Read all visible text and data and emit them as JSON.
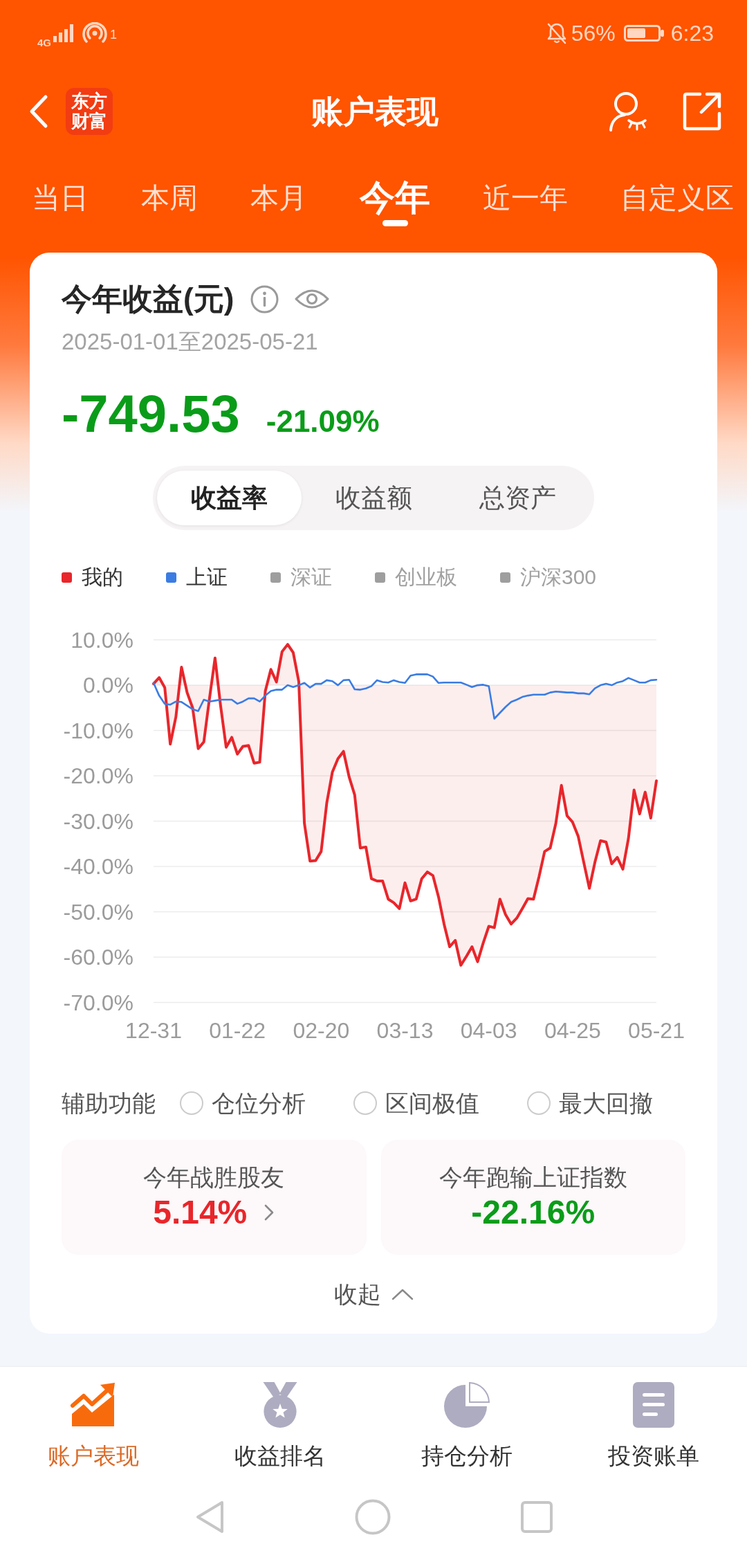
{
  "status_bar": {
    "network": "4G",
    "hotspot_count": "1",
    "battery": "56%",
    "time": "6:23"
  },
  "header": {
    "logo_text": "东方财富",
    "title": "账户表现"
  },
  "period_tabs": [
    {
      "label": "当日",
      "selected": false
    },
    {
      "label": "本周",
      "selected": false
    },
    {
      "label": "本月",
      "selected": false
    },
    {
      "label": "今年",
      "selected": true
    },
    {
      "label": "近一年",
      "selected": false
    },
    {
      "label": "自定义区",
      "selected": false
    }
  ],
  "summary": {
    "title": "今年收益(元)",
    "date_range": "2025-01-01至2025-05-21",
    "amount": "-749.53",
    "rate": "-21.09%",
    "positive": false
  },
  "metric_tabs": [
    {
      "label": "收益率",
      "selected": true
    },
    {
      "label": "收益额",
      "selected": false
    },
    {
      "label": "总资产",
      "selected": false
    }
  ],
  "chart": {
    "legend": [
      {
        "label": "我的",
        "selected": true,
        "color": "#e8262b"
      },
      {
        "label": "上证",
        "selected": true,
        "color": "#3b7ce2"
      },
      {
        "label": "深证",
        "selected": false,
        "color": "#9e9e9e"
      },
      {
        "label": "创业板",
        "selected": false,
        "color": "#9e9e9e"
      },
      {
        "label": "沪深300",
        "selected": false,
        "color": "#9e9e9e"
      }
    ],
    "chart_data": {
      "type": "area",
      "grid": true,
      "categories": [
        "12-31",
        null,
        null,
        null,
        null,
        null,
        null,
        null,
        null,
        null,
        null,
        null,
        null,
        null,
        null,
        "01-22",
        null,
        null,
        null,
        null,
        null,
        null,
        null,
        null,
        null,
        null,
        null,
        null,
        null,
        null,
        "02-20",
        null,
        null,
        null,
        null,
        null,
        null,
        null,
        null,
        null,
        null,
        null,
        null,
        null,
        null,
        "03-13",
        null,
        null,
        null,
        null,
        null,
        null,
        null,
        null,
        null,
        null,
        null,
        null,
        null,
        null,
        "04-03",
        null,
        null,
        null,
        null,
        null,
        null,
        null,
        null,
        null,
        null,
        null,
        null,
        null,
        null,
        "04-25",
        null,
        null,
        null,
        null,
        null,
        null,
        null,
        null,
        null,
        null,
        null,
        null,
        null,
        null,
        "05-21"
      ],
      "series": [
        {
          "color": "#e8262b",
          "values": [
            0.3,
            1.7,
            -0.5,
            -13.0,
            -7.0,
            4.0,
            -1.6,
            -5.0,
            -14.0,
            -12.5,
            -3.0,
            6.0,
            -4.5,
            -13.7,
            -11.5,
            -15.2,
            -13.5,
            -13.3,
            -17.2,
            -17.0,
            -1.3,
            3.5,
            0.7,
            7.4,
            9.0,
            7.2,
            0.8,
            -30.5,
            -38.8,
            -38.7,
            -36.7,
            -26.0,
            -19.2,
            -16.2,
            -14.6,
            -20.2,
            -24.2,
            -35.9,
            -35.7,
            -42.7,
            -43.2,
            -43.2,
            -47.2,
            -48.0,
            -49.3,
            -43.6,
            -47.6,
            -47.2,
            -42.7,
            -41.2,
            -42.0,
            -46.7,
            -52.7,
            -57.7,
            -56.3,
            -61.8,
            -59.8,
            -57.7,
            -61.0,
            -56.9,
            -53.2,
            -53.5,
            -47.2,
            -50.6,
            -52.7,
            -51.4,
            -49.3,
            -47.1,
            -47.2,
            -42.2,
            -36.7,
            -35.9,
            -30.5,
            -22.1,
            -28.8,
            -30.2,
            -33.3,
            -39.1,
            -44.8,
            -39.1,
            -34.3,
            -34.6,
            -39.4,
            -38.0,
            -40.6,
            -33.8,
            -23.1,
            -28.4,
            -23.6,
            -29.3,
            -21.1
          ]
        },
        {
          "type": "line",
          "color": "#3b7ce2",
          "values": [
            0.5,
            -2.3,
            -4.1,
            -4.3,
            -3.6,
            -3.7,
            -4.5,
            -5.3,
            -5.7,
            -3.2,
            -3.6,
            -3.4,
            -3.2,
            -3.2,
            -3.2,
            -4.1,
            -3.6,
            -2.9,
            -2.9,
            -3.6,
            -2.3,
            -1.3,
            -1.0,
            -1.0,
            0.0,
            -0.4,
            0.0,
            0.5,
            -0.5,
            0.3,
            0.3,
            1.1,
            0.9,
            0.0,
            1.1,
            1.2,
            -0.9,
            -1.0,
            -0.7,
            -0.2,
            1.1,
            0.7,
            0.6,
            1.1,
            0.7,
            0.5,
            2.1,
            2.4,
            2.4,
            2.4,
            1.9,
            0.5,
            0.6,
            0.6,
            0.6,
            0.6,
            0.1,
            -0.4,
            0.0,
            0.1,
            -0.2,
            -7.4,
            -6.1,
            -4.8,
            -3.7,
            -3.2,
            -2.6,
            -2.3,
            -2.1,
            -2.1,
            -2.1,
            -1.6,
            -1.4,
            -1.5,
            -1.6,
            -1.6,
            -1.8,
            -1.8,
            -2.0,
            -0.7,
            0.0,
            0.3,
            0.0,
            0.6,
            0.9,
            1.6,
            1.1,
            0.6,
            0.6,
            1.1,
            1.2
          ]
        }
      ],
      "ylim": [
        -70,
        10
      ],
      "yticks": [
        {
          "value": 10,
          "label": "10.0%"
        },
        {
          "value": 0,
          "label": "0.0%"
        },
        {
          "value": -10,
          "label": "-10.0%"
        },
        {
          "value": -20,
          "label": "-20.0%"
        },
        {
          "value": -30,
          "label": "-30.0%"
        },
        {
          "value": -40,
          "label": "-40.0%"
        },
        {
          "value": -50,
          "label": "-50.0%"
        },
        {
          "value": -60,
          "label": "-60.0%"
        },
        {
          "value": -70,
          "label": "-70.0%"
        }
      ]
    }
  },
  "aux": {
    "label": "辅助功能",
    "options": [
      {
        "label": "仓位分析",
        "selected": false
      },
      {
        "label": "区间极值",
        "selected": false
      },
      {
        "label": "最大回撤",
        "selected": false
      }
    ]
  },
  "stats": [
    {
      "label": "今年战胜股友",
      "value": "5.14%",
      "positive": true,
      "link": true
    },
    {
      "label": "今年跑输上证指数",
      "value": "-22.16%",
      "positive": false,
      "link": false
    }
  ],
  "collapse": {
    "label": "收起"
  },
  "bottom_nav": [
    {
      "label": "账户表现",
      "selected": true
    },
    {
      "label": "收益排名",
      "selected": false
    },
    {
      "label": "持仓分析",
      "selected": false
    },
    {
      "label": "投资账单",
      "selected": false
    }
  ]
}
